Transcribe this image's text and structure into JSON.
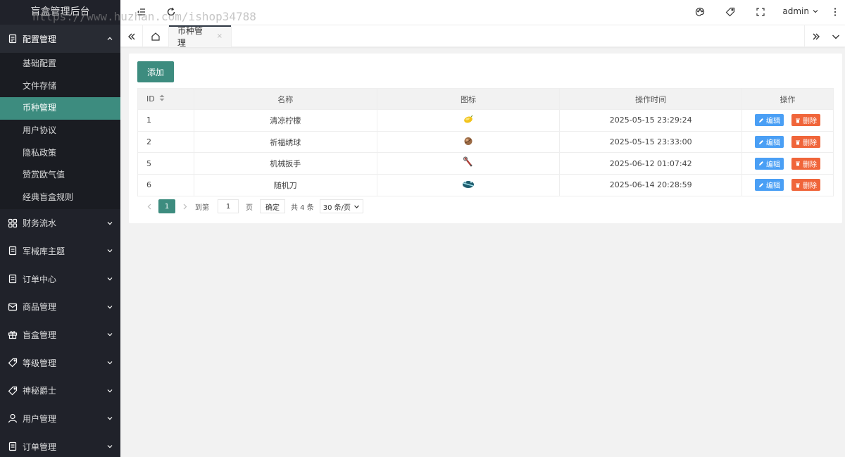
{
  "app": {
    "title": "盲盒管理后台",
    "watermark": "https://www.huzhan.com/ishop34788"
  },
  "header": {
    "user": "admin"
  },
  "sidebar": {
    "open_group": {
      "label": "配置管理",
      "icon": "settings-doc-icon"
    },
    "sub_items": [
      {
        "label": "基础配置"
      },
      {
        "label": "文件存储"
      },
      {
        "label": "币种管理",
        "active": true
      },
      {
        "label": "用户协议"
      },
      {
        "label": "隐私政策"
      },
      {
        "label": "赞赏欧气值"
      },
      {
        "label": "经典盲盒规则"
      }
    ],
    "groups": [
      {
        "label": "财务流水",
        "icon": "grid-icon"
      },
      {
        "label": "军械库主题",
        "icon": "doc-icon"
      },
      {
        "label": "订单中心",
        "icon": "doc-icon"
      },
      {
        "label": "商品管理",
        "icon": "mail-icon"
      },
      {
        "label": "盲盒管理",
        "icon": "gift-icon"
      },
      {
        "label": "等级管理",
        "icon": "tag-icon"
      },
      {
        "label": "神秘爵士",
        "icon": "tag-icon"
      },
      {
        "label": "用户管理",
        "icon": "user-icon"
      },
      {
        "label": "订单管理",
        "icon": "doc-icon"
      }
    ]
  },
  "tabs": {
    "active": "币种管理",
    "close": "×"
  },
  "main": {
    "add_label": "添加",
    "columns": [
      "ID",
      "名称",
      "图标",
      "操作时间",
      "操作"
    ],
    "rows": [
      {
        "id": "1",
        "name": "清凉柠檬",
        "icon": "lemon-icon",
        "time": "2025-05-15 23:29:24"
      },
      {
        "id": "2",
        "name": "祈福绣球",
        "icon": "ball-icon",
        "time": "2025-05-15 23:33:00"
      },
      {
        "id": "5",
        "name": "机械扳手",
        "icon": "wrench-icon",
        "time": "2025-06-12 01:07:42"
      },
      {
        "id": "6",
        "name": "随机刀",
        "icon": "knife-icon",
        "time": "2025-06-14 20:28:59"
      }
    ],
    "edit_label": "编辑",
    "delete_label": "删除"
  },
  "pager": {
    "current": "1",
    "goto_label": "到第",
    "goto_value": "1",
    "page_label": "页",
    "confirm_label": "确定",
    "total_label": "共 4 条",
    "size_label": "30 条/页"
  },
  "colors": {
    "accent": "#3d8c7f",
    "sidebar": "#20222a",
    "edit": "#4a9ff5",
    "delete": "#f0653a"
  }
}
